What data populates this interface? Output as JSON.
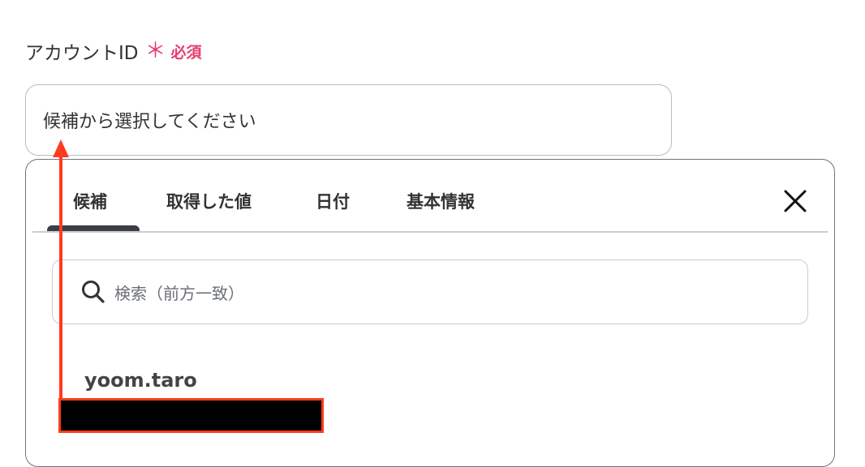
{
  "field": {
    "label": "アカウントID",
    "asterisk": "＊",
    "required": "必須",
    "placeholder": "候補から選択してください"
  },
  "tabs": [
    {
      "label": "候補",
      "active": true
    },
    {
      "label": "取得した値",
      "active": false
    },
    {
      "label": "日付",
      "active": false
    },
    {
      "label": "基本情報",
      "active": false
    }
  ],
  "search": {
    "placeholder": "検索（前方一致）"
  },
  "options": [
    {
      "name": "yoom.taro"
    }
  ],
  "colors": {
    "required": "#e63e6d",
    "annotation": "#ff3b1f",
    "border": "#b8bcc4"
  },
  "icons": {
    "close": "close-icon",
    "search": "search-icon"
  }
}
